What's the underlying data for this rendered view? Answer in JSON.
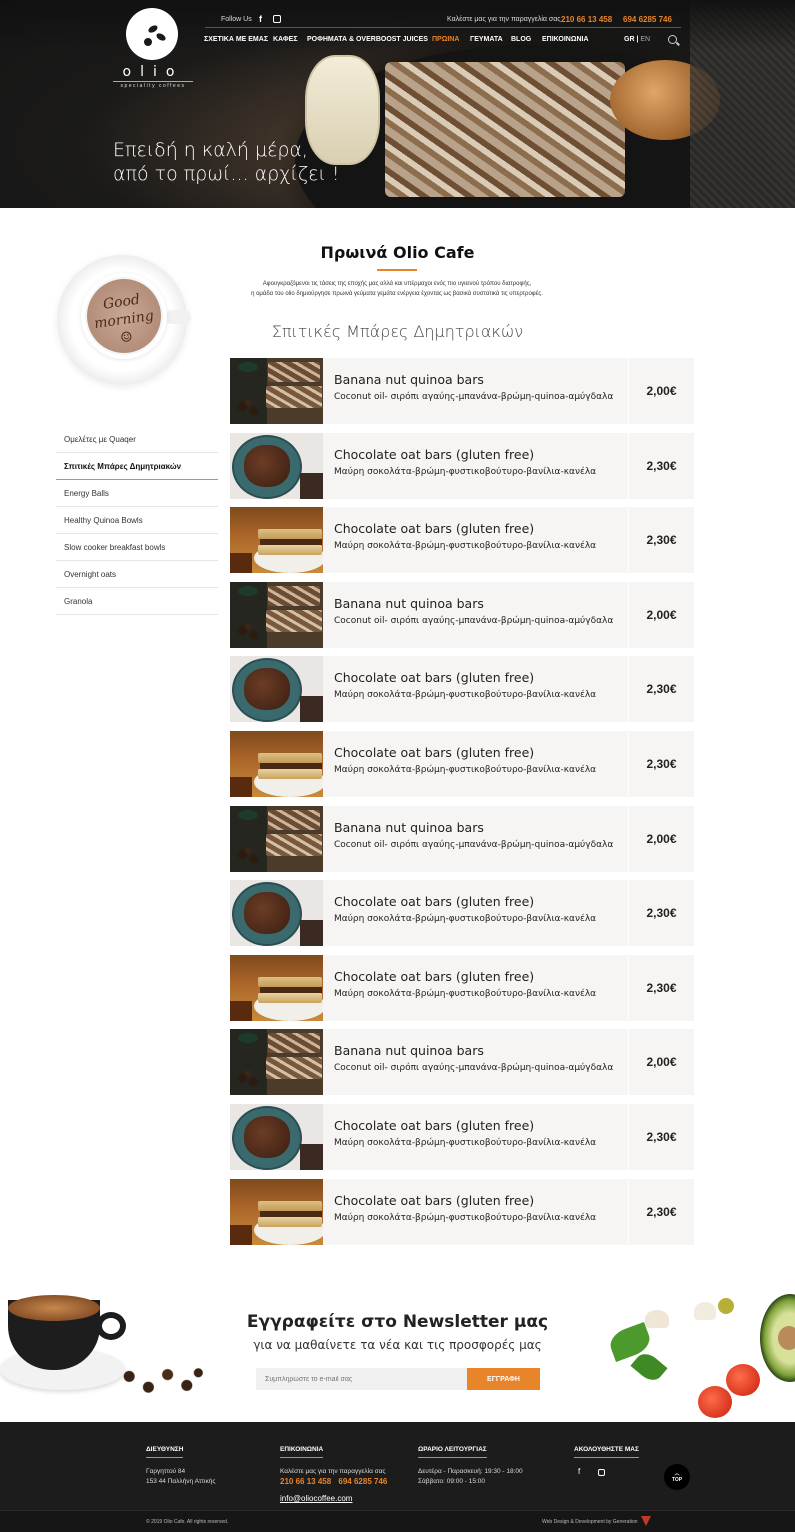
{
  "header": {
    "follow_label": "Follow Us",
    "facebook_glyph": "f",
    "call_label": "Καλέστε μας για την παραγγελία σας",
    "phone1": "210  66 13 458",
    "phone2": "694 6285 746",
    "logo_word": "olio",
    "logo_sub": "speciality coffees",
    "nav": [
      "ΣΧΕΤΙΚΑ ΜΕ ΕΜΑΣ",
      "ΚΑΦΕΣ",
      "ΡΟΦΗΜΑΤΑ  & OVERBOOST  JUICES",
      "ΠΡΩΙΝΑ",
      "ΓΕΥΜΑΤΑ",
      "BLOG",
      "ΕΠΙΚΟΙΝΩΝΙΑ"
    ],
    "active_nav": "ΠΡΩΙΝΑ",
    "lang_gr": "GR",
    "lang_sep": "|",
    "lang_en": "EN",
    "tagline_line1": "Επειδή η καλή μέρα,",
    "tagline_line2": "από το πρωί... αρχίζει !"
  },
  "cup_text_line1": "Good",
  "cup_text_line2": "morning",
  "cup_text_line3": "☺",
  "sidebar": {
    "items": [
      "Ομελέτες με Quaqer",
      "Σπιτικές Μπάρες Δημητριακών",
      "Energy Balls",
      "Healthy Quinoa Bowls",
      "Slow cooker breakfast bowls",
      "Overnight oats",
      "Granola"
    ],
    "selected": "Σπιτικές Μπάρες Δημητριακών"
  },
  "main": {
    "title": "Πρωινά Olio  Cafe",
    "intro_line1": "Αφουγκραζόμενοι τις τάσεις της εποχής μας αλλά και υπέρμαχοι ενός πιο υγιεινού τρόπου διατροφής,",
    "intro_line2": "η ομάδα του olio δημιούργησε πρωινά γεύματα γεμάτα ενέργεια έχοντας ως βασικά συστατικά τις υπερτροφές.",
    "subtitle": "Σπιτικές Μπάρες Δημητριακών",
    "products": [
      {
        "name": "Banana nut quinoa bars",
        "desc": "Coconut oil- σιρόπι αγαύης-μπανάνα-βρώμη-quinoa-αμύγδαλα",
        "price": "2,00€",
        "thumb": "bars"
      },
      {
        "name": "Chocolate oat bars (gluten free)",
        "desc": "Μαύρη σοκολάτα-βρώμη-φυστικοβούτυρο-βανίλια-κανέλα",
        "price": "2,30€",
        "thumb": "choc"
      },
      {
        "name": "Chocolate oat bars (gluten free)",
        "desc": "Μαύρη σοκολάτα-βρώμη-φυστικοβούτυρο-βανίλια-κανέλα",
        "price": "2,30€",
        "thumb": "cake"
      },
      {
        "name": "Banana nut quinoa bars",
        "desc": "Coconut oil- σιρόπι αγαύης-μπανάνα-βρώμη-quinoa-αμύγδαλα",
        "price": "2,00€",
        "thumb": "bars"
      },
      {
        "name": "Chocolate oat bars (gluten free)",
        "desc": "Μαύρη σοκολάτα-βρώμη-φυστικοβούτυρο-βανίλια-κανέλα",
        "price": "2,30€",
        "thumb": "choc"
      },
      {
        "name": "Chocolate oat bars (gluten free)",
        "desc": "Μαύρη σοκολάτα-βρώμη-φυστικοβούτυρο-βανίλια-κανέλα",
        "price": "2,30€",
        "thumb": "cake"
      },
      {
        "name": "Banana nut quinoa bars",
        "desc": "Coconut oil- σιρόπι αγαύης-μπανάνα-βρώμη-quinoa-αμύγδαλα",
        "price": "2,00€",
        "thumb": "bars"
      },
      {
        "name": "Chocolate oat bars (gluten free)",
        "desc": "Μαύρη σοκολάτα-βρώμη-φυστικοβούτυρο-βανίλια-κανέλα",
        "price": "2,30€",
        "thumb": "choc"
      },
      {
        "name": "Chocolate oat bars (gluten free)",
        "desc": "Μαύρη σοκολάτα-βρώμη-φυστικοβούτυρο-βανίλια-κανέλα",
        "price": "2,30€",
        "thumb": "cake"
      },
      {
        "name": "Banana nut quinoa bars",
        "desc": "Coconut oil- σιρόπι αγαύης-μπανάνα-βρώμη-quinoa-αμύγδαλα",
        "price": "2,00€",
        "thumb": "bars"
      },
      {
        "name": "Chocolate oat bars (gluten free)",
        "desc": "Μαύρη σοκολάτα-βρώμη-φυστικοβούτυρο-βανίλια-κανέλα",
        "price": "2,30€",
        "thumb": "choc"
      },
      {
        "name": "Chocolate oat bars (gluten free)",
        "desc": "Μαύρη σοκολάτα-βρώμη-φυστικοβούτυρο-βανίλια-κανέλα",
        "price": "2,30€",
        "thumb": "cake"
      }
    ]
  },
  "newsletter": {
    "title": "Εγγραφείτε στο Newsletter μας",
    "subtitle": "για να μαθαίνετε τα νέα και τις προσφορές μας",
    "placeholder": "Συμπληρώστε το e-mail σας",
    "button": "ΕΓΓΡΑΦΗ"
  },
  "footer": {
    "address_title": "ΔΙΕΥΘΥΝΣΗ",
    "address_line1": "Γαργηττού 84",
    "address_line2": "153 44 Παλλήνη Αττικής",
    "contact_title": "ΕΠΙΚΟΙΝΩΝΙΑ",
    "contact_text": "Καλέστε μας για την παραγγελία σας",
    "phone1": "210  66 13 458",
    "phone2": "694 6285 746",
    "email": "info@oliocoffee.com",
    "hours_title": "ΩΡΑΡΙΟ ΛΕΙΤΟΥΡΓΙΑΣ",
    "hours_line1": "Δευτέρα - Παρασκευή: 19:30 - 18:00",
    "hours_line2": "Σάββατο: 09:00 - 15:00",
    "follow_title": "ΑΚΟΛΟΥΘΗΣΤΕ ΜΑΣ",
    "facebook_glyph": "f",
    "top_button": "TOP",
    "copyright": "© 2019 Olio Cafe. All rights reserved.",
    "credit": "Web Design & Development by Generation"
  },
  "colors": {
    "accent": "#e8842a",
    "footer_bg": "#1c1c1c",
    "row_bg": "#f6f5f3"
  }
}
